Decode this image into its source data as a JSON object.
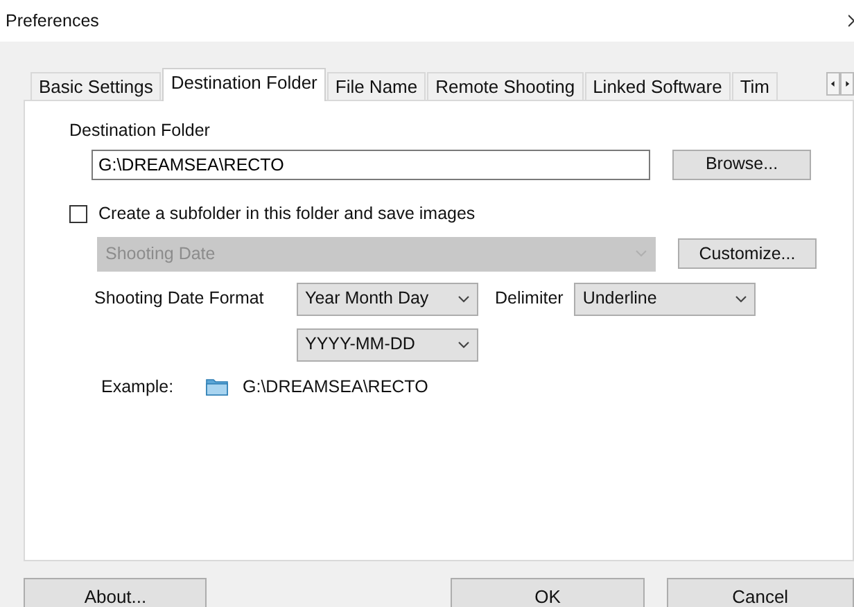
{
  "window": {
    "title": "Preferences"
  },
  "tabs": [
    {
      "label": "Basic Settings",
      "selected": false
    },
    {
      "label": "Destination Folder",
      "selected": true
    },
    {
      "label": "File Name",
      "selected": false
    },
    {
      "label": "Remote Shooting",
      "selected": false
    },
    {
      "label": "Linked Software",
      "selected": false
    },
    {
      "label": "Tim",
      "selected": false
    }
  ],
  "destination": {
    "label": "Destination Folder",
    "value": "G:\\DREAMSEA\\RECTO",
    "browse_button": "Browse..."
  },
  "subfolder": {
    "label": "Create a subfolder in this folder and save images",
    "checked": false,
    "select": "Shooting Date",
    "select_disabled": true,
    "customize_button": "Customize..."
  },
  "date_format": {
    "label": "Shooting Date Format",
    "order": "Year Month Day",
    "delimiter_label": "Delimiter",
    "delimiter": "Underline",
    "pattern": "YYYY-MM-DD"
  },
  "example": {
    "label": "Example:",
    "path": "G:\\DREAMSEA\\RECTO"
  },
  "buttons": [
    {
      "label": "About..."
    },
    {
      "label": "OK"
    },
    {
      "label": "Cancel"
    }
  ]
}
